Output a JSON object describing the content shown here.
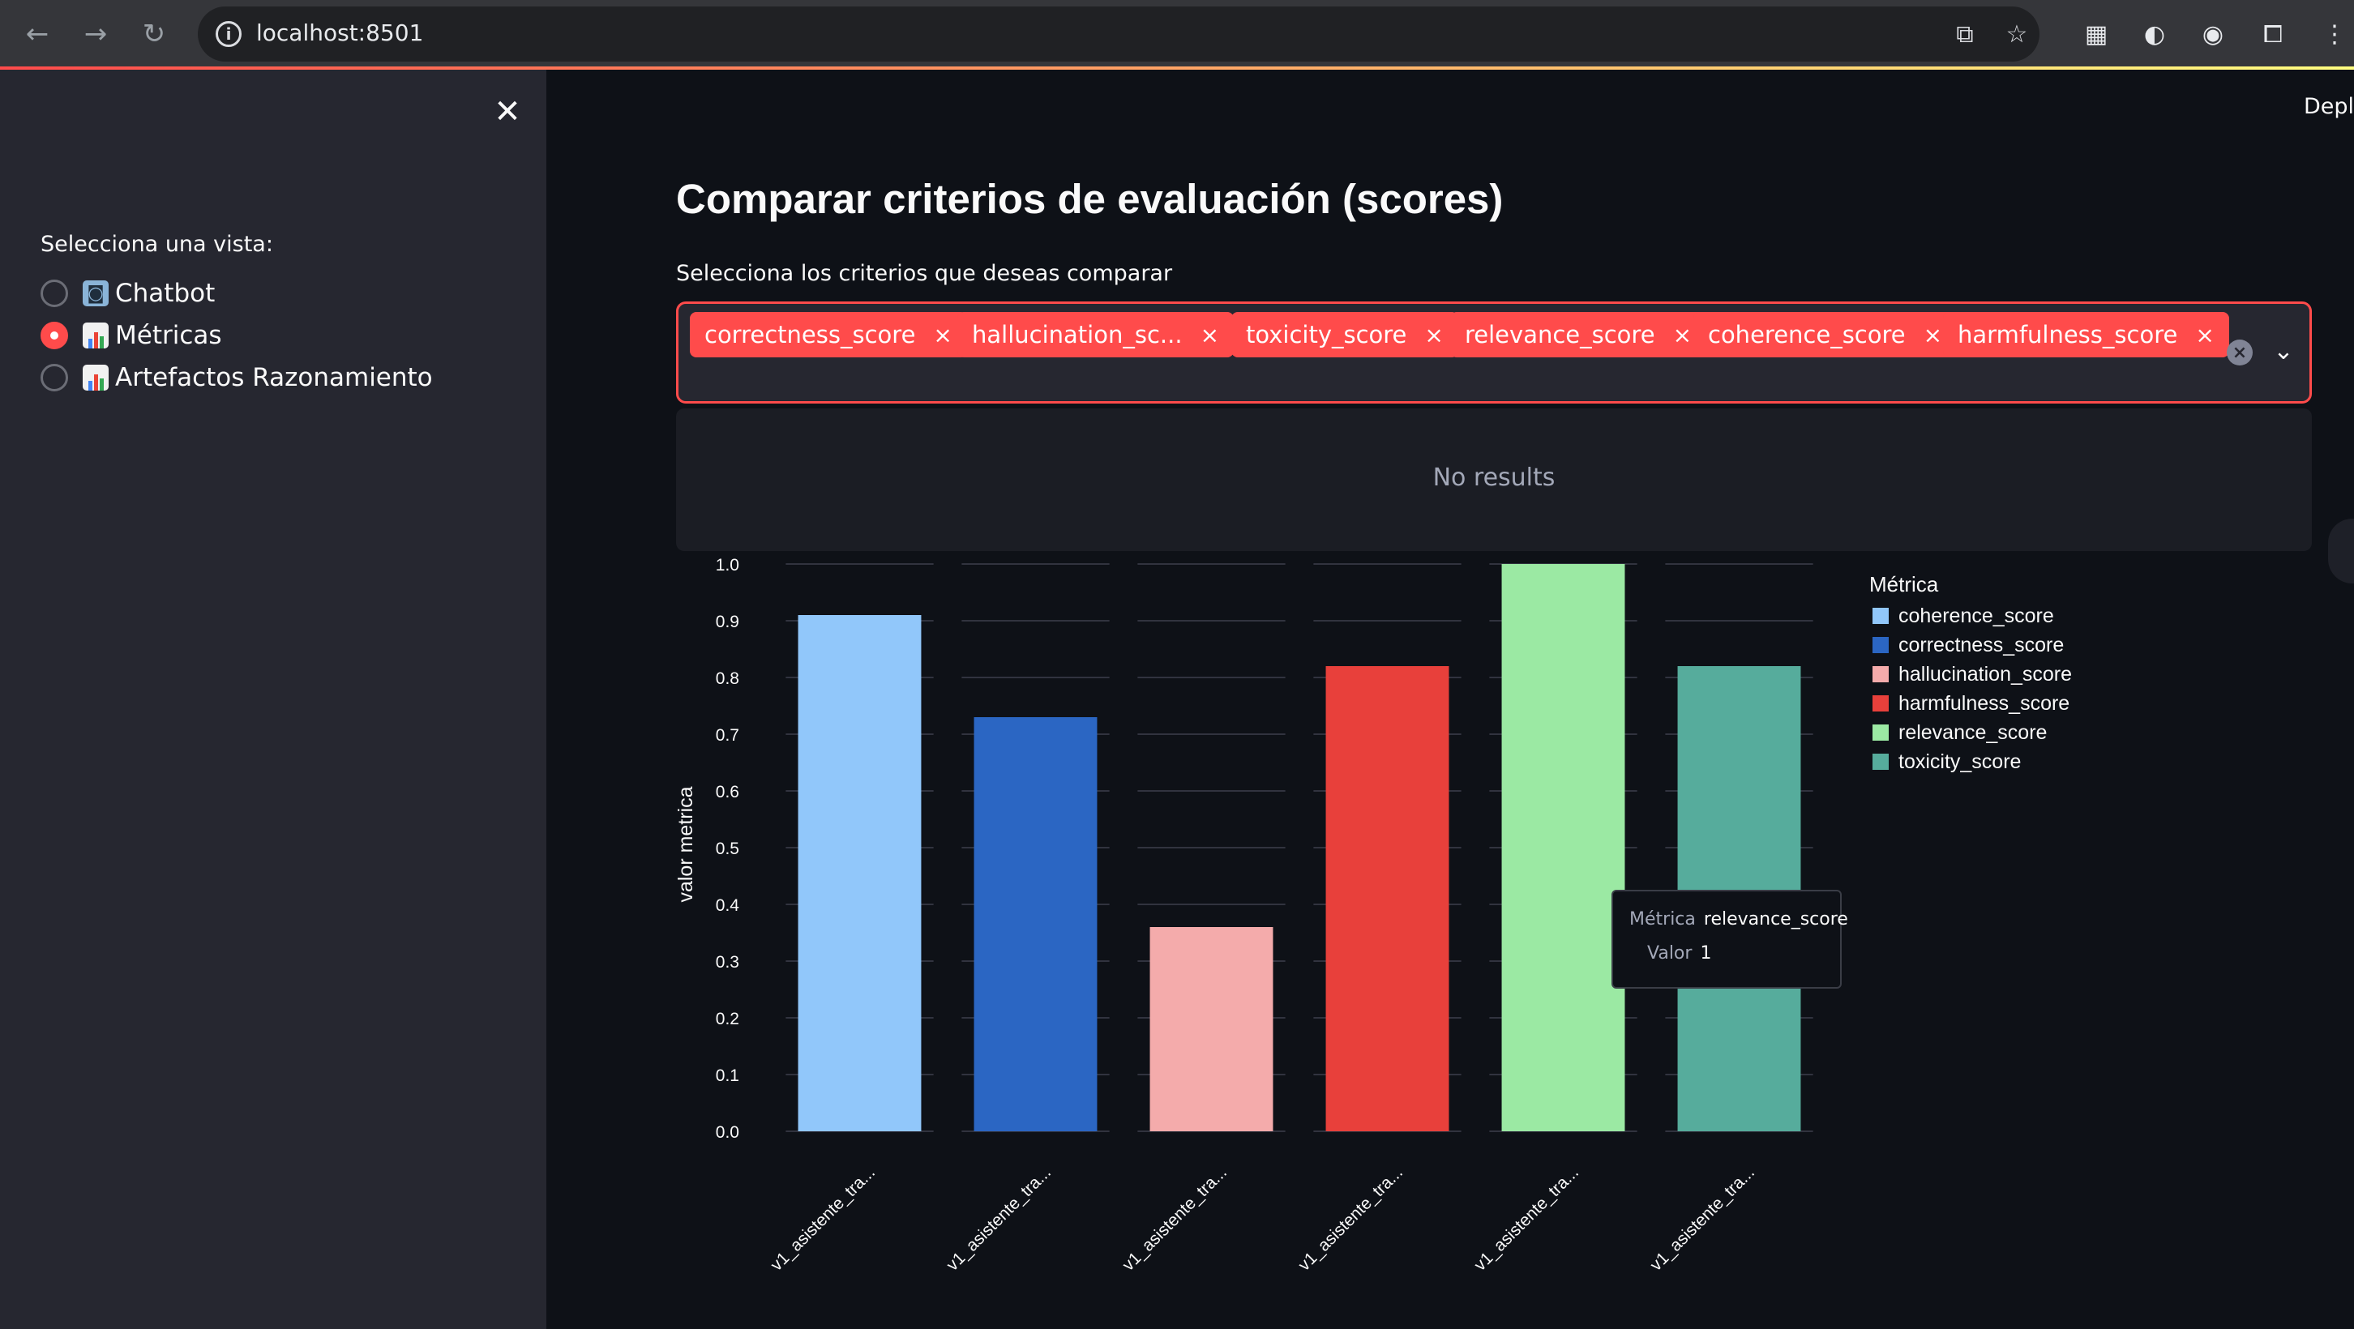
{
  "browser": {
    "url": "localhost:8501",
    "icons": [
      "back-arrow-icon",
      "forward-arrow-icon",
      "reload-icon",
      "site-info-icon",
      "translate-icon",
      "star-icon"
    ]
  },
  "sidebar": {
    "view_label": "Selecciona una vista:",
    "options": [
      {
        "label": "Chatbot",
        "icon": "robot-emoji",
        "selected": false
      },
      {
        "label": "Métricas",
        "icon": "chart-emoji",
        "selected": true
      },
      {
        "label": "Artefactos Razonamiento",
        "icon": "chart-emoji",
        "selected": false
      }
    ]
  },
  "header": {
    "deploy_label": "Deplo"
  },
  "main": {
    "title": "Comparar criterios de evaluación (scores)",
    "select_label": "Selecciona los criterios que deseas comparar",
    "chips": [
      "correctness_score",
      "hallucination_sc...",
      "toxicity_score",
      "relevance_score",
      "coherence_score",
      "harmfulness_score"
    ],
    "chip_remove_glyph": "×",
    "no_results": "No results"
  },
  "colors": {
    "accent": "#ff4b4b",
    "background": "#0e1117",
    "sidebar": "#262730"
  },
  "tooltip": {
    "metric_key": "Métrica",
    "metric_value": "relevance_score",
    "value_key": "Valor",
    "value_value": "1"
  },
  "chart_data": {
    "type": "bar",
    "title": "",
    "xlabel": "",
    "ylabel": "valor metrica",
    "ylim": [
      0,
      1
    ],
    "yticks": [
      "0.0",
      "0.1",
      "0.2",
      "0.3",
      "0.4",
      "0.5",
      "0.6",
      "0.7",
      "0.8",
      "0.9",
      "1.0"
    ],
    "categories": [
      "v1_asistente_tra...",
      "v1_asistente_tra...",
      "v1_asistente_tra...",
      "v1_asistente_tra...",
      "v1_asistente_tra...",
      "v1_asistente_tra..."
    ],
    "legend_title": "Métrica",
    "legend_position": "right",
    "series": [
      {
        "name": "coherence_score",
        "color": "#91c7fa",
        "values": [
          0.91,
          null,
          null,
          null,
          null,
          null
        ]
      },
      {
        "name": "correctness_score",
        "color": "#2b66c3",
        "values": [
          null,
          0.73,
          null,
          null,
          null,
          null
        ]
      },
      {
        "name": "hallucination_score",
        "color": "#f4abab",
        "values": [
          null,
          null,
          0.36,
          null,
          null,
          null
        ]
      },
      {
        "name": "harmfulness_score",
        "color": "#e8403b",
        "values": [
          null,
          null,
          null,
          0.82,
          null,
          null
        ]
      },
      {
        "name": "relevance_score",
        "color": "#9be9a3",
        "values": [
          null,
          null,
          null,
          null,
          1.0,
          null
        ]
      },
      {
        "name": "toxicity_score",
        "color": "#56ac9c",
        "values": [
          null,
          null,
          null,
          null,
          null,
          0.82
        ]
      }
    ]
  }
}
